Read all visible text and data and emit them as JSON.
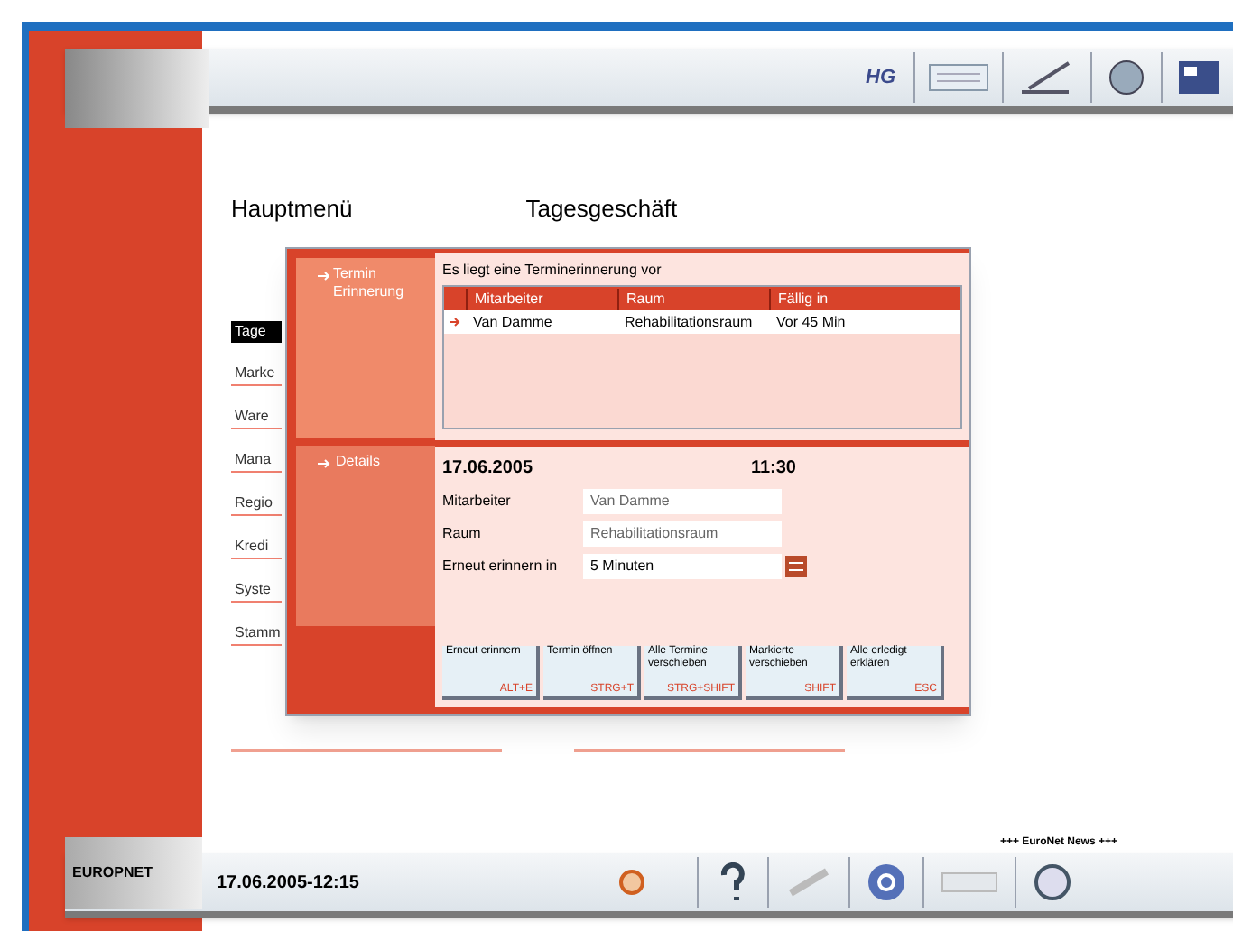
{
  "top_toolbar": {
    "home_label": "HG"
  },
  "headings": [
    "Hauptmenü",
    "Tagesgeschäft"
  ],
  "menu": [
    {
      "label": "Tage",
      "selected": true
    },
    {
      "label": "Marke",
      "selected": false
    },
    {
      "label": "Ware",
      "selected": false
    },
    {
      "label": "Mana",
      "selected": false
    },
    {
      "label": "Regio",
      "selected": false
    },
    {
      "label": "Kredi",
      "selected": false
    },
    {
      "label": "Syste",
      "selected": false
    },
    {
      "label": "Stamm",
      "selected": false
    }
  ],
  "dialog": {
    "sections": [
      {
        "label": "Termin Erinnerung",
        "selected": true
      },
      {
        "label": "Details",
        "selected": false
      }
    ],
    "notice": "Es liegt eine Terminerinnerung vor",
    "table": {
      "columns": [
        "Mitarbeiter",
        "Raum",
        "Fällig in"
      ],
      "rows": [
        {
          "cells": [
            "Van Damme",
            "Rehabilitationsraum",
            "Vor 45 Min"
          ],
          "selected": true
        }
      ]
    },
    "date": "17.06.2005",
    "time": "11:30",
    "fields": [
      {
        "label": "Mitarbeiter",
        "value": "Van Damme"
      },
      {
        "label": "Raum",
        "value": "Rehabilitationsraum"
      }
    ],
    "remind": {
      "label": "Erneut erinnern in",
      "value": "5 Minuten"
    },
    "buttons": [
      {
        "label": "Erneut erinnern",
        "shortcut": "ALT+E"
      },
      {
        "label": "Termin öffnen",
        "shortcut": "STRG+T"
      },
      {
        "label": "Alle Termine verschieben",
        "shortcut": "STRG+SHIFT"
      },
      {
        "label": "Markierte verschieben",
        "shortcut": "SHIFT"
      },
      {
        "label": "Alle erledigt erklären",
        "shortcut": "ESC"
      }
    ]
  },
  "status_bar": {
    "logo": "EUROPNET",
    "datetime": "17.06.2005-12:15",
    "news": "+++ EuroNet News +++"
  }
}
